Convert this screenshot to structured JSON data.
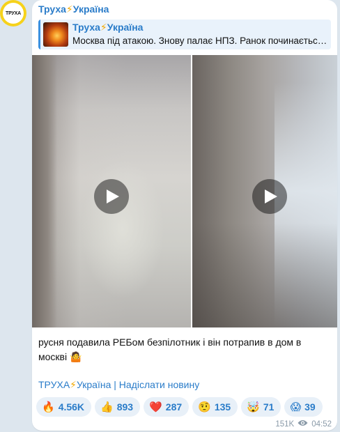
{
  "channel": {
    "avatar_text": "ТРУХА",
    "name_part1": "Труха",
    "bolt": "⚡",
    "name_part2": "Україна"
  },
  "reply": {
    "title_part1": "Труха",
    "bolt": "⚡",
    "title_part2": "Україна",
    "text": "Москва під атакою. Знову палає НПЗ. Ранок починається..."
  },
  "message": {
    "text": "русня подавила РЕБом безпілотник і він потрапив в дом в москві 🤷"
  },
  "footer": {
    "part1": "ТРУХА",
    "bolt": "⚡",
    "part2": "Україна | Надіслати новину"
  },
  "reactions": [
    {
      "emoji": "🔥",
      "count": "4.56K"
    },
    {
      "emoji": "👍",
      "count": "893"
    },
    {
      "emoji": "❤️",
      "count": "287"
    },
    {
      "emoji": "🤨",
      "count": "135"
    },
    {
      "emoji": "🤯",
      "count": "71"
    },
    {
      "emoji": "😱",
      "count": "39"
    }
  ],
  "meta": {
    "views": "151K",
    "time": "04:52"
  }
}
